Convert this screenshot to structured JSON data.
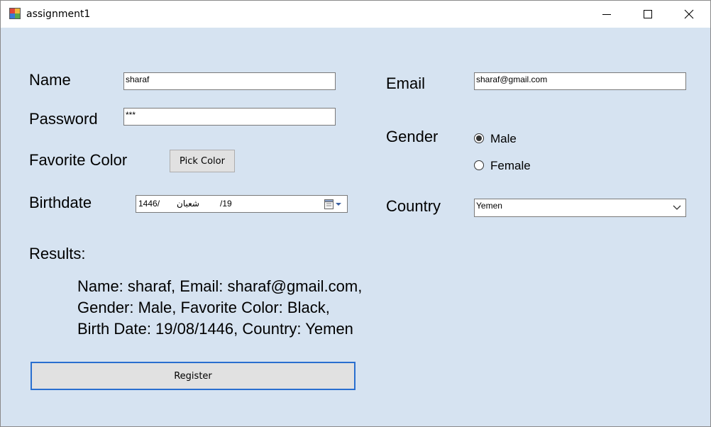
{
  "window": {
    "title": "assignment1"
  },
  "form": {
    "name_label": "Name",
    "name_value": "sharaf",
    "password_label": "Password",
    "password_value": "***",
    "favorite_color_label": "Favorite Color",
    "pick_color_button": "Pick Color",
    "birthdate_label": "Birthdate",
    "birthdate": {
      "year": "1446/",
      "month": "شعبان",
      "day": "/19"
    },
    "email_label": "Email",
    "email_value": "sharaf@gmail.com",
    "gender_label": "Gender",
    "gender_options": [
      {
        "label": "Male",
        "selected": true
      },
      {
        "label": "Female",
        "selected": false
      }
    ],
    "country_label": "Country",
    "country_value": "Yemen",
    "results_label": "Results:",
    "results_lines": [
      "Name: sharaf,  Email: sharaf@gmail.com,",
      "Gender: Male,  Favorite Color: Black,",
      "Birth Date: 19/08/1446,  Country: Yemen"
    ],
    "register_button": "Register"
  },
  "icons": {
    "app": "app-icon",
    "minimize": "minimize-icon",
    "maximize": "maximize-icon",
    "close": "close-icon",
    "calendar": "calendar-icon",
    "dropdown": "chevron-down-icon"
  },
  "colors": {
    "client_background": "#d6e3f1",
    "title_background": "#ffffff"
  }
}
